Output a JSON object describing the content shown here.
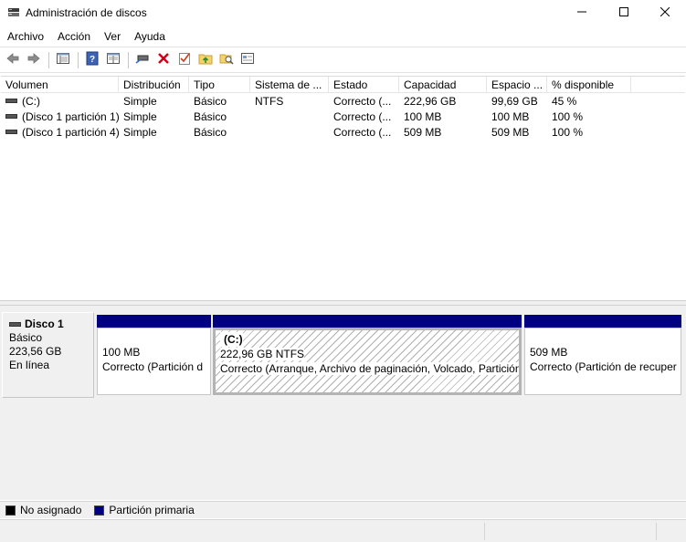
{
  "window": {
    "title": "Administración de discos",
    "app_icon": "disk-management-icon",
    "controls": [
      "minimize-icon",
      "maximize-icon",
      "close-icon"
    ]
  },
  "menu": {
    "items": [
      "Archivo",
      "Acción",
      "Ver",
      "Ayuda"
    ]
  },
  "toolbar": {
    "buttons": [
      "back-arrow-icon",
      "forward-arrow-icon",
      "properties-pane-icon",
      "help-icon",
      "list-view-icon",
      "connect-drive-icon",
      "delete-icon",
      "check-icon",
      "open-folder-up-icon",
      "search-folder-icon",
      "console-pane-icon"
    ]
  },
  "volume_list": {
    "columns": [
      "Volumen",
      "Distribución",
      "Tipo",
      "Sistema de ...",
      "Estado",
      "Capacidad",
      "Espacio ...",
      "% disponible"
    ],
    "rows": [
      [
        "(C:)",
        "Simple",
        "Básico",
        "NTFS",
        "Correcto (...",
        "222,96 GB",
        "99,69 GB",
        "45 %"
      ],
      [
        "(Disco 1 partición 1)",
        "Simple",
        "Básico",
        "",
        "Correcto (...",
        "100 MB",
        "100 MB",
        "100 %"
      ],
      [
        "(Disco 1 partición 4)",
        "Simple",
        "Básico",
        "",
        "Correcto (...",
        "509 MB",
        "509 MB",
        "100 %"
      ]
    ]
  },
  "disk": {
    "name": "Disco 1",
    "type": "Básico",
    "size": "223,56 GB",
    "status": "En línea",
    "partitions": [
      {
        "label": "",
        "size": "100 MB",
        "status": "Correcto (Partición d"
      },
      {
        "label": "(C:)",
        "size": "222,96 GB NTFS",
        "status": "Correcto (Arranque, Archivo de paginación, Volcado, Partición"
      },
      {
        "label": "",
        "size": "509 MB",
        "status": "Correcto (Partición de recuper"
      }
    ]
  },
  "legend": {
    "items": [
      {
        "label": "No asignado",
        "color": "#000000"
      },
      {
        "label": "Partición primaria",
        "color": "#000080"
      }
    ]
  }
}
